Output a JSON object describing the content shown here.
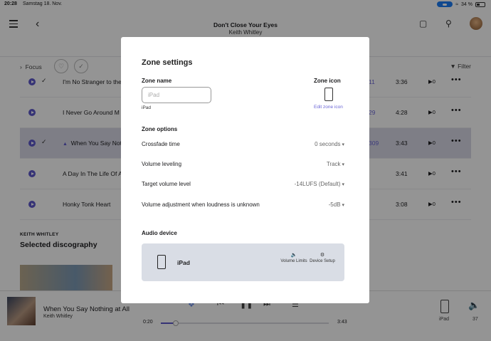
{
  "statusbar": {
    "time": "20:28",
    "date": "Samstag 18. Nov.",
    "battery": "34 %"
  },
  "header": {
    "title": "Don't Close Your Eyes",
    "artist": "Keith Whitley"
  },
  "focusbar": {
    "focus_label": "Focus",
    "filter_label": "Filter"
  },
  "tracks": [
    {
      "title": "I'm No Stranger to the",
      "extra": "11",
      "duration": "3:36",
      "plays": "0"
    },
    {
      "title": "I Never Go Around M",
      "extra": "29",
      "duration": "4:28",
      "plays": "0"
    },
    {
      "title": "When You Say Nothin",
      "extra": "309",
      "duration": "3:43",
      "plays": "0"
    },
    {
      "title": "A Day In The Life Of A",
      "extra": "",
      "duration": "3:41",
      "plays": "0"
    },
    {
      "title": "Honky Tonk Heart",
      "extra": "",
      "duration": "3:08",
      "plays": "0"
    }
  ],
  "discography": {
    "artist": "KEITH WHITLEY",
    "title": "Selected discography"
  },
  "player": {
    "title": "When You Say Nothing at All",
    "artist": "Keith Whitley",
    "elapsed": "0:20",
    "total": "3:43",
    "progress": 0.09,
    "zone": "iPad",
    "volume": "37"
  },
  "modal": {
    "title": "Zone settings",
    "zone_name_label": "Zone name",
    "zone_name_placeholder": "iPad",
    "zone_name_sub": "iPad",
    "zone_icon_label": "Zone icon",
    "edit_zone_icon": "Edit zone icon",
    "zone_options_label": "Zone options",
    "options": [
      {
        "label": "Crossfade time",
        "value": "0 seconds"
      },
      {
        "label": "Volume leveling",
        "value": "Track"
      },
      {
        "label": "Target volume level",
        "value": "-14LUFS (Default)"
      },
      {
        "label": "Volume adjustment when loudness is unknown",
        "value": "-5dB"
      }
    ],
    "audio_device_label": "Audio device",
    "device": {
      "name": "iPad",
      "volume_limits": "Volume Limits",
      "device_setup": "Device Setup"
    }
  }
}
